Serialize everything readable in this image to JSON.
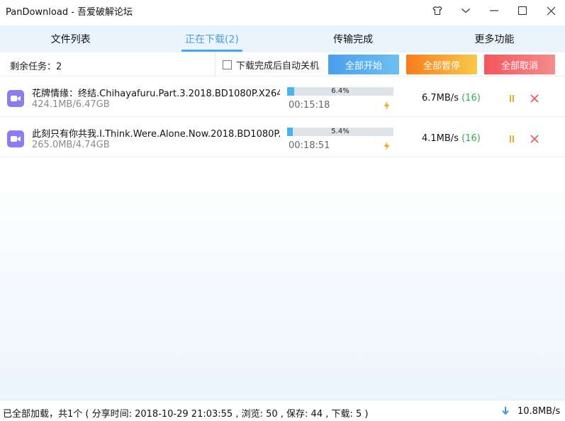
{
  "window": {
    "title": "PanDownload - 吾爱破解论坛"
  },
  "tabs": [
    {
      "label": "文件列表",
      "active": false
    },
    {
      "label": "正在下载(2)",
      "active": true
    },
    {
      "label": "传输完成",
      "active": false
    },
    {
      "label": "更多功能",
      "active": false
    }
  ],
  "toolbar": {
    "remaining": "剩余任务：2",
    "auto_shutdown_label": "下载完成后自动关机",
    "auto_shutdown_checked": false,
    "start_all": "全部开始",
    "pause_all": "全部暂停",
    "cancel_all": "全部取消"
  },
  "downloads": [
    {
      "name": "花牌情缘：终结.Chihayafuru.Part.3.2018.BD1080P.X264...",
      "size": "424.1MB/6.47GB",
      "progress": 6.4,
      "progress_text": "6.4%",
      "eta": "00:15:18",
      "speed": "6.7MB/s",
      "connections": "(16)"
    },
    {
      "name": "此刻只有你共我.I.Think.Were.Alone.Now.2018.BD1080P....",
      "size": "265.0MB/4.74GB",
      "progress": 5.4,
      "progress_text": "5.4%",
      "eta": "00:18:51",
      "speed": "4.1MB/s",
      "connections": "(16)"
    }
  ],
  "status": {
    "text": "已全部加载，共1个 ( 分享时间: 2018-10-29 21:03:55 , 浏览: 50 , 保存: 44 , 下载: 5 )",
    "total_speed": "10.8MB/s"
  },
  "colors": {
    "accent": "#4a9fe0",
    "progress": "#46b4ee",
    "start_button": "#4a9ff0",
    "pause_button": "#f97c1c",
    "cancel_button": "#f4555e",
    "file_icon": "#8b7cf0",
    "connections": "#2bb34a"
  },
  "icons": {
    "skin": "tshirt-icon",
    "menu": "chevron-down-icon",
    "minimize": "minimize-icon",
    "maximize": "maximize-icon",
    "close": "close-icon",
    "file": "video-file-icon",
    "turbo": "lightning-icon",
    "row_pause": "pause-icon",
    "row_cancel": "cancel-x-icon",
    "download": "download-arrow-icon"
  }
}
